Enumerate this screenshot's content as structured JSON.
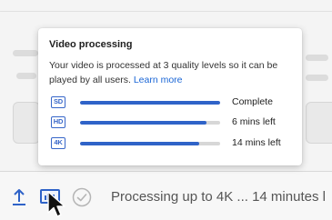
{
  "tooltip": {
    "title": "Video processing",
    "description": "Your video is processed at 3 quality levels so it can be played by all users.",
    "link": "Learn more",
    "rows": [
      {
        "badge": "SD",
        "progress": 1.0,
        "status": "Complete"
      },
      {
        "badge": "HD",
        "progress": 0.9,
        "status": "6 mins left"
      },
      {
        "badge": "4K",
        "progress": 0.85,
        "status": "14 mins left"
      }
    ]
  },
  "footer": {
    "status_text": "Processing up to 4K ... 14 minutes l"
  },
  "colors": {
    "accent": "#2f63c8",
    "track": "#d7d7d7",
    "link": "#1a66d6"
  }
}
